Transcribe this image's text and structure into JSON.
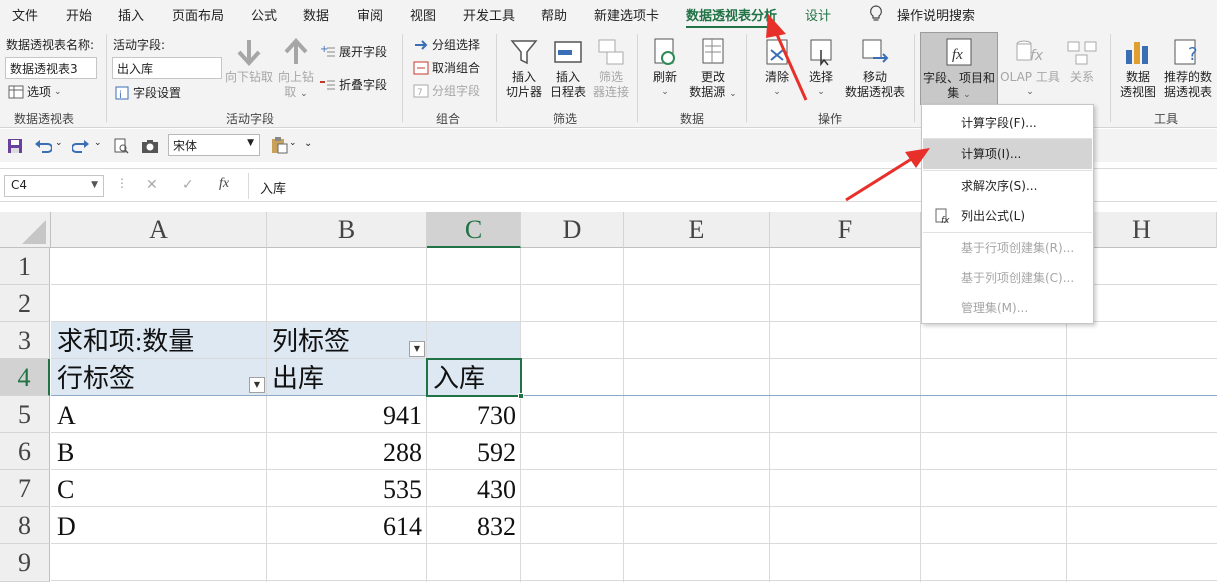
{
  "menu": {
    "tabs": [
      "文件",
      "开始",
      "插入",
      "页面布局",
      "公式",
      "数据",
      "审阅",
      "视图",
      "开发工具",
      "帮助",
      "新建选项卡",
      "数据透视表分析",
      "设计"
    ],
    "active_tab": "数据透视表分析",
    "search": "操作说明搜索"
  },
  "ribbon": {
    "pivot_group": {
      "name_label": "数据透视表名称:",
      "name_value": "数据透视表3",
      "options": "选项",
      "label": "数据透视表"
    },
    "field_group": {
      "active_label": "活动字段:",
      "active_value": "出入库",
      "field_settings": "字段设置",
      "drill_down": "向下钻取",
      "drill_up_1": "向上钻",
      "drill_up_2": "取",
      "expand": "展开字段",
      "collapse": "折叠字段",
      "label": "活动字段"
    },
    "group_group": {
      "group_selection": "分组选择",
      "ungroup": "取消组合",
      "group_field": "分组字段",
      "label": "组合"
    },
    "filter_group": {
      "slicer_1": "插入",
      "slicer_2": "切片器",
      "timeline_1": "插入",
      "timeline_2": "日程表",
      "conn_1": "筛选",
      "conn_2": "器连接",
      "label": "筛选"
    },
    "data_group": {
      "refresh": "刷新",
      "change_1": "更改",
      "change_2": "数据源",
      "label": "数据"
    },
    "action_group": {
      "clear": "清除",
      "select": "选择",
      "move_1": "移动",
      "move_2": "数据透视表",
      "label": "操作"
    },
    "calc_group": {
      "fields_1": "字段、项目和",
      "fields_2": "集",
      "olap": "OLAP 工具",
      "relations": "关系"
    },
    "tools_group": {
      "chart_1": "数据",
      "chart_2": "透视图",
      "rec_1": "推荐的数",
      "rec_2": "据透视表",
      "label": "工具"
    }
  },
  "qat": {
    "font": "宋体"
  },
  "formula_bar": {
    "name_box": "C4",
    "fx": "fx",
    "content": "入库"
  },
  "grid": {
    "columns": [
      "A",
      "B",
      "C",
      "D",
      "E",
      "F",
      "G",
      "H"
    ],
    "rows": [
      "1",
      "2",
      "3",
      "4",
      "5",
      "6",
      "7",
      "8",
      "9"
    ],
    "selected_column": "C",
    "selected_row": "4",
    "pivot": {
      "r3_a": "求和项:数量",
      "r3_b": "列标签",
      "r4_a": "行标签",
      "r4_b": "出库",
      "r4_c": "入库",
      "rows": [
        {
          "label": "A",
          "out": "941",
          "in": "730"
        },
        {
          "label": "B",
          "out": "288",
          "in": "592"
        },
        {
          "label": "C",
          "out": "535",
          "in": "430"
        },
        {
          "label": "D",
          "out": "614",
          "in": "832"
        }
      ]
    }
  },
  "dropdown": {
    "items": [
      "计算字段(F)...",
      "计算项(I)...",
      "求解次序(S)...",
      "列出公式(L)",
      "基于行项创建集(R)...",
      "基于列项创建集(C)...",
      "管理集(M)..."
    ],
    "highlighted": "计算项(I)..."
  },
  "colors": {
    "accent_green": "#217346",
    "pivot_fill": "#dde8f3",
    "arrow_red": "#e8302a"
  }
}
